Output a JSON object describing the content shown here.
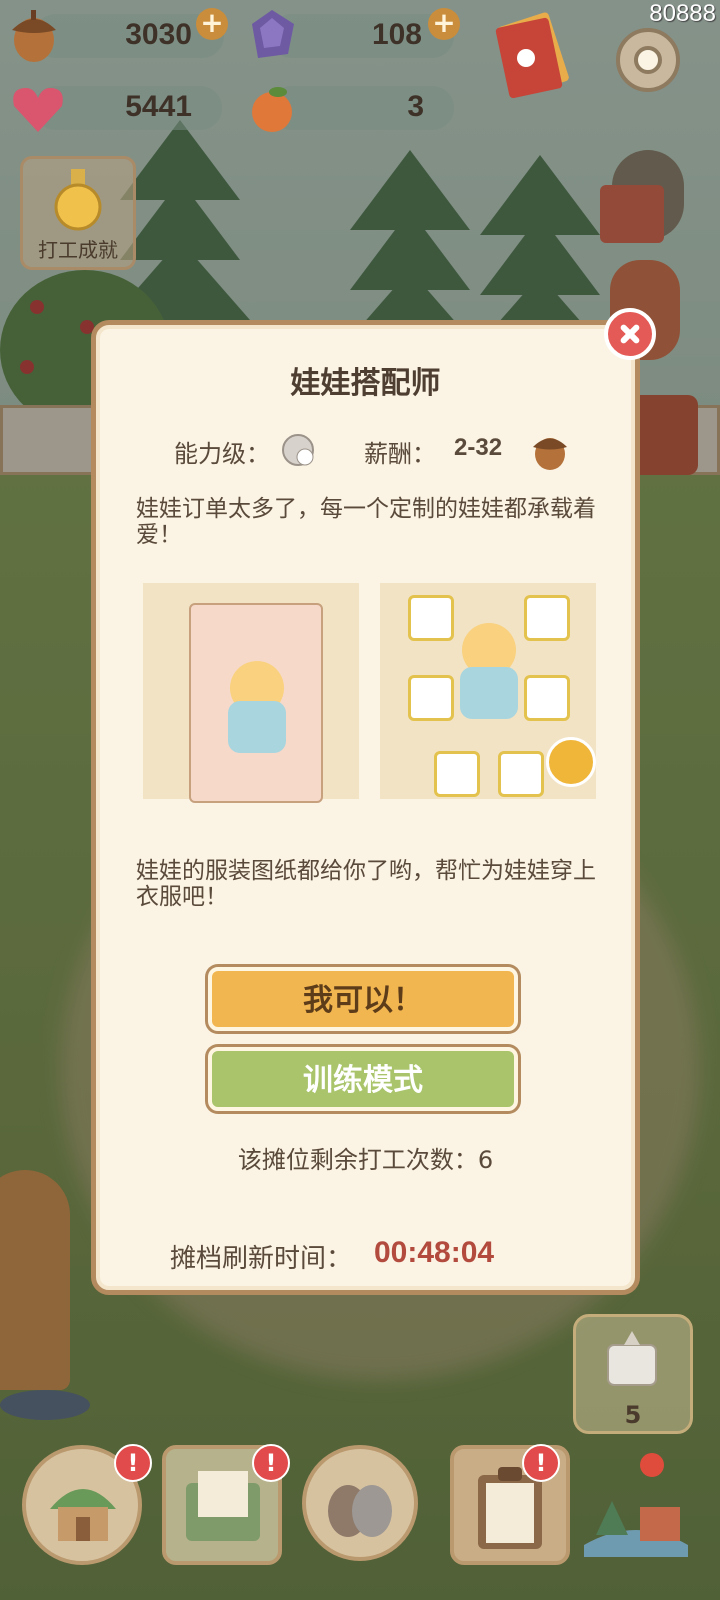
{
  "top_bar": {
    "acorn_value": "3030",
    "gem_value": "108",
    "heart_value": "5441",
    "orange_value": "3",
    "counter": "80888"
  },
  "side": {
    "achievement_label": "打工成就"
  },
  "modal": {
    "title": "娃娃搭配师",
    "ability_label": "能力级：",
    "salary_label": "薪酬：",
    "salary_value": "2-32",
    "intro_text": "娃娃订单太多了，每一个定制的娃娃都承载着爱！",
    "instruction_text": "娃娃的服装图纸都给你了哟，帮忙为娃娃穿上衣服吧！",
    "accept_button": "我可以！",
    "training_button": "训练模式",
    "remaining_text": "该摊位剩余打工次数：6",
    "refresh_label": "摊档刷新时间：",
    "refresh_time": "00:48:04"
  },
  "gift": {
    "count": "5"
  },
  "colors": {
    "accent_orange": "#f2b650",
    "accent_green": "#a9c46a",
    "timer_red": "#b24a3d",
    "close_red": "#e45a56"
  }
}
